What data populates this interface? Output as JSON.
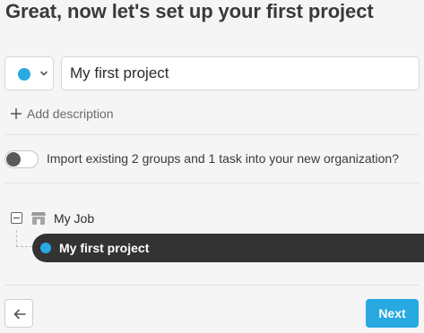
{
  "header": {
    "title": "Great, now let's set up your first project"
  },
  "project_form": {
    "color_picker": {
      "selected_color": "#29a9e1",
      "icon": "chevron-down-icon"
    },
    "name_input": {
      "value": "My first project"
    },
    "add_description_label": "Add description"
  },
  "import_toggle": {
    "enabled": false,
    "label": "Import existing 2 groups and 1 task into your new organization?"
  },
  "tree": {
    "organization": {
      "label": "My Job",
      "icon": "organization-icon",
      "expanded": true
    },
    "project": {
      "label": "My first project",
      "color": "#29a9e1",
      "selected": true
    }
  },
  "footer": {
    "back_icon": "arrow-left-icon",
    "next_label": "Next"
  },
  "colors": {
    "accent": "#29a9e1",
    "selected_row": "#333333",
    "background": "#f5f5f5"
  }
}
